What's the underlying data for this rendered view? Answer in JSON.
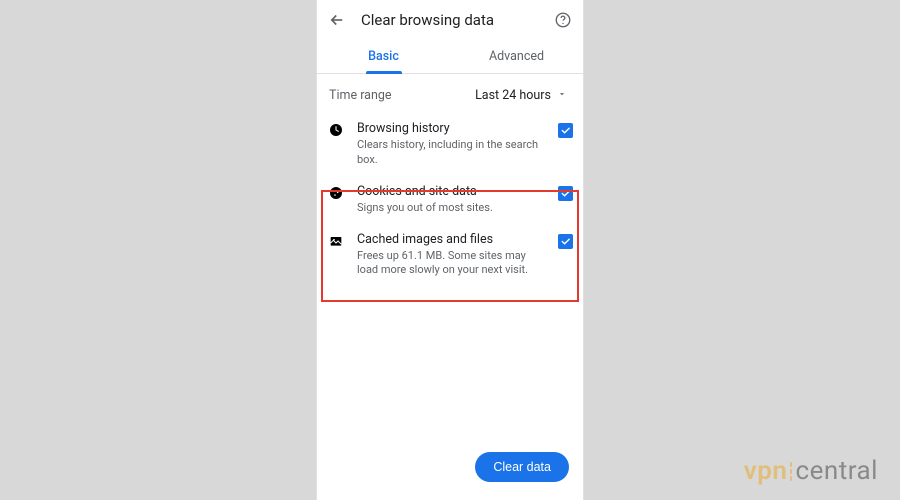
{
  "header": {
    "title": "Clear browsing data"
  },
  "tabs": {
    "basic": "Basic",
    "advanced": "Advanced"
  },
  "timerange": {
    "label": "Time range",
    "value": "Last 24 hours"
  },
  "options": {
    "history": {
      "title": "Browsing history",
      "desc": "Clears history, including in the search box."
    },
    "cookies": {
      "title": "Cookies and site data",
      "desc": "Signs you out of most sites."
    },
    "cache": {
      "title": "Cached images and files",
      "desc": "Frees up 61.1 MB. Some sites may load more slowly on your next visit."
    }
  },
  "actions": {
    "clear": "Clear data"
  },
  "branding": {
    "part1": "vpn",
    "part2": "central"
  },
  "colors": {
    "accent": "#1a73e8",
    "highlight": "#e23b2e",
    "brand1": "#e9a92e",
    "brand2": "#4a4a4a"
  }
}
